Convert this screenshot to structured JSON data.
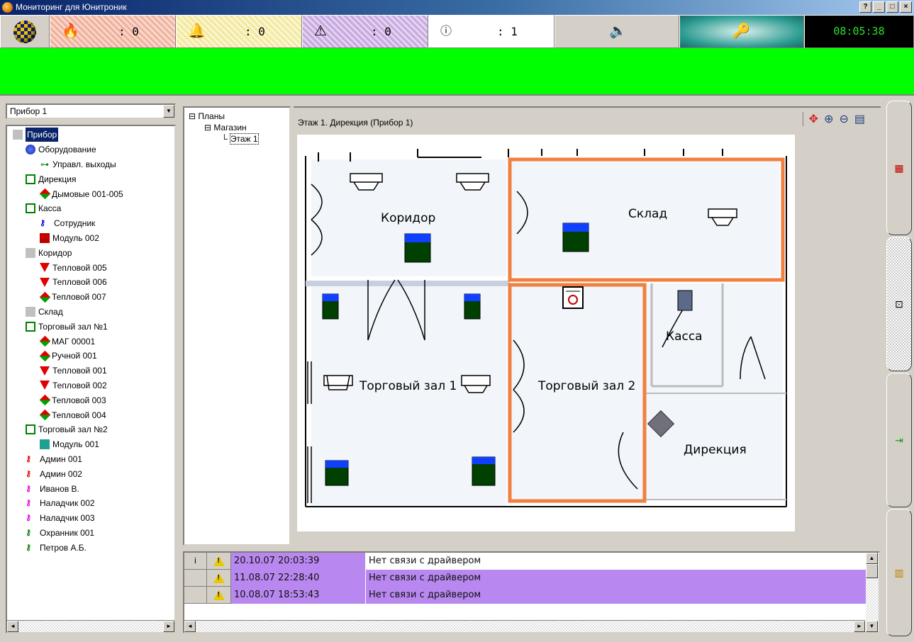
{
  "window": {
    "title": "Мониторинг для Юнитроник"
  },
  "status": {
    "fire_count": ": 0",
    "bell_count": ": 0",
    "warn_count": ": 0",
    "info_count": ": 1",
    "clock": "08:05:38"
  },
  "left": {
    "combo_value": "Прибор 1",
    "tree": [
      {
        "label": "Прибор",
        "indent": 1,
        "marker": "grey-sq",
        "selected": true
      },
      {
        "label": "Оборудование",
        "indent": 2,
        "marker": "equip"
      },
      {
        "label": "Управл. выходы",
        "indent": 3,
        "marker": "out"
      },
      {
        "label": "Дирекция",
        "indent": 2,
        "marker": "green-sq"
      },
      {
        "label": "Дымовые 001-005",
        "indent": 3,
        "marker": "diam"
      },
      {
        "label": "Касса",
        "indent": 2,
        "marker": "green-sq"
      },
      {
        "label": "Сотрудник",
        "indent": 3,
        "marker": "key-blue"
      },
      {
        "label": "Модуль 002",
        "indent": 3,
        "marker": "red-sq"
      },
      {
        "label": "Коридор",
        "indent": 2,
        "marker": "grey-sq"
      },
      {
        "label": "Тепловой 005",
        "indent": 3,
        "marker": "tri"
      },
      {
        "label": "Тепловой 006",
        "indent": 3,
        "marker": "tri"
      },
      {
        "label": "Тепловой 007",
        "indent": 3,
        "marker": "diam"
      },
      {
        "label": "Склад",
        "indent": 2,
        "marker": "grey-sq"
      },
      {
        "label": "Торговый зал №1",
        "indent": 2,
        "marker": "green-sq"
      },
      {
        "label": "МАГ 00001",
        "indent": 3,
        "marker": "diam"
      },
      {
        "label": "Ручной 001",
        "indent": 3,
        "marker": "diam"
      },
      {
        "label": "Тепловой 001",
        "indent": 3,
        "marker": "tri"
      },
      {
        "label": "Тепловой 002",
        "indent": 3,
        "marker": "tri"
      },
      {
        "label": "Тепловой 003",
        "indent": 3,
        "marker": "diam"
      },
      {
        "label": "Тепловой 004",
        "indent": 3,
        "marker": "diam"
      },
      {
        "label": "Торговый зал №2",
        "indent": 2,
        "marker": "green-sq"
      },
      {
        "label": "Модуль 001",
        "indent": 3,
        "marker": "teal-sq"
      },
      {
        "label": "Админ 001",
        "indent": 2,
        "marker": "key-red"
      },
      {
        "label": "Админ 002",
        "indent": 2,
        "marker": "key-red"
      },
      {
        "label": "Иванов В.",
        "indent": 2,
        "marker": "key-magenta"
      },
      {
        "label": "Наладчик 002",
        "indent": 2,
        "marker": "key-magenta"
      },
      {
        "label": "Наладчик 003",
        "indent": 2,
        "marker": "key-magenta"
      },
      {
        "label": "Охранник 001",
        "indent": 2,
        "marker": "key-green"
      },
      {
        "label": "Петров А.Б.",
        "indent": 2,
        "marker": "key-green"
      }
    ]
  },
  "schemes": {
    "root": "Планы",
    "child": "Магазин",
    "leaf": "Этаж 1"
  },
  "plan": {
    "title": "Этаж 1. Дирекция (Прибор 1)",
    "rooms": {
      "corridor": "Коридор",
      "storage": "Склад",
      "hall1": "Торговый зал 1",
      "hall2": "Торговый зал 2",
      "cashier": "Касса",
      "director": "Дирекция"
    }
  },
  "events": [
    {
      "col0": "i",
      "time": "20.10.07 20:03:39",
      "text": "Нет связи с драйвером"
    },
    {
      "col0": "",
      "time": "11.08.07 22:28:40",
      "text": "Нет связи с драйвером"
    },
    {
      "col0": "",
      "time": "10.08.07 18:53:43",
      "text": "Нет связи с драйвером"
    }
  ],
  "colors": {
    "alarm_bar": "#00ff00",
    "highlight_room": "#f08040",
    "event_row": "#b888f0",
    "clock_text": "#2ae02a"
  }
}
